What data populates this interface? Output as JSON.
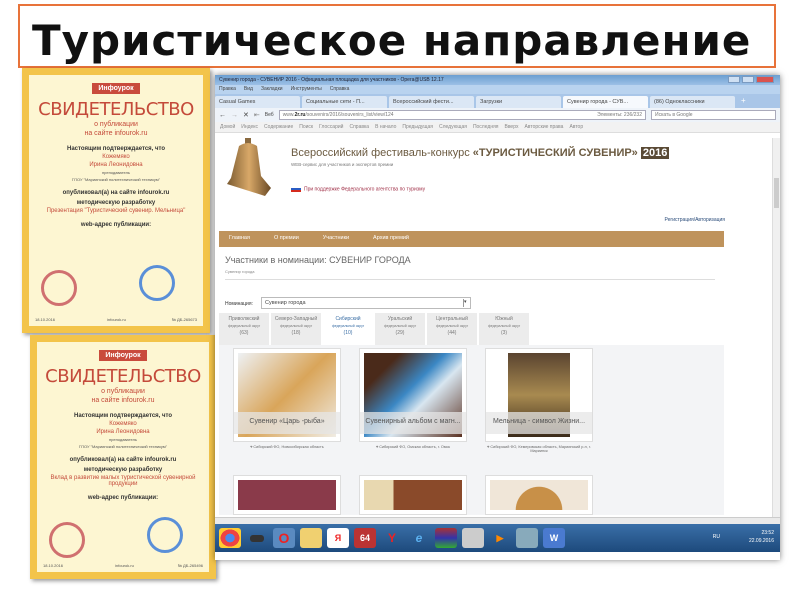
{
  "slide": {
    "title": "Туристическое направление"
  },
  "certificates": [
    {
      "logo": "Инфоурок",
      "heading": "СВИДЕТЕЛЬСТВО",
      "sub1": "о публикации",
      "sub2": "на сайте infourok.ru",
      "confirm": "Настоящим подтверждается, что",
      "surname": "Кожемяко",
      "name": "Ирина Леонидовна",
      "role": "преподаватель",
      "org": "ГПОУ \"Мариинский политехнический техникум\"",
      "published": "опубликовал(а) на сайте infourok.ru",
      "work_type": "методическую разработку",
      "work_title": "Презентация \"Туристический сувенир. Мельница\"",
      "web_label": "web-адрес публикации:",
      "site": "infourok.ru",
      "date": "18.10.2016",
      "number": "№ ДБ-265673"
    },
    {
      "logo": "Инфоурок",
      "heading": "СВИДЕТЕЛЬСТВО",
      "sub1": "о публикации",
      "sub2": "на сайте infourok.ru",
      "confirm": "Настоящим подтверждается, что",
      "surname": "Кожемяко",
      "name": "Ирина Леонидовна",
      "role": "преподаватель",
      "org": "ГПОУ \"Мариинский политехнический техникум\"",
      "published": "опубликовал(а) на сайте infourok.ru",
      "work_type": "методическую разработку",
      "work_title": "Вклад в развитие малых туристической сувенирной продукции",
      "web_label": "web-адрес публикации:",
      "site": "infourok.ru",
      "date": "18.10.2016",
      "number": "№ ДБ-265496"
    }
  ],
  "browser": {
    "window_title": "Сувенир города - СУВЕНИР 2016 - Официальная площадка для участников - Opera@USB 12.17",
    "menu": [
      "Правка",
      "Вид",
      "Закладки",
      "Инструменты",
      "Справка"
    ],
    "tabs": [
      {
        "label": "Casual Games"
      },
      {
        "label": "Социальные сети - П..."
      },
      {
        "label": "Всероссийский фести..."
      },
      {
        "label": "Загрузки"
      },
      {
        "label": "Сувенир города - СУВ...",
        "active": true
      },
      {
        "label": "(86) Одноклассники"
      }
    ],
    "address_prefix": "www.",
    "address_domain": "2r.ru",
    "address_path": "/souvenirs/2016/souvenirs_list/view/124",
    "web_badge": "Веб",
    "elements_count": "Элементы: 236/232",
    "search_placeholder": "Искать в Google",
    "nav_links": [
      "Домой",
      "Индекс",
      "Содержание",
      "Поиск",
      "Глоссарий",
      "Справка",
      "В начало",
      "Предыдущая",
      "Следующая",
      "Последняя",
      "Вверх",
      "Авторские права",
      "Автор"
    ]
  },
  "site": {
    "title_main": "Всероссийский фестиваль-конкурс ",
    "title_bold": "«ТУРИСТИЧЕСКИЙ СУВЕНИР»",
    "year": "2016",
    "subtitle": "WEB-сервис для участников и экспертов премии",
    "support": "При поддержке Федерального агентства по туризму",
    "register": "Регистрация/Авторизация",
    "nav": [
      "Главная",
      "О премии",
      "Участники",
      "Архив премий"
    ],
    "page_title": "Участники в номинации: СУВЕНИР ГОРОДА",
    "breadcrumb": "Сувенир города",
    "nomination_label": "Номинация:",
    "nomination_value": "Сувенир города",
    "district_sub": "федеральный округ",
    "districts": [
      {
        "name": "Приволжский",
        "count": "(63)"
      },
      {
        "name": "Северо-Западный",
        "count": "(18)"
      },
      {
        "name": "Сибирский",
        "count": "(10)",
        "active": true
      },
      {
        "name": "Уральский",
        "count": "(29)"
      },
      {
        "name": "Центральный",
        "count": "(44)"
      },
      {
        "name": "Южный",
        "count": "(3)"
      }
    ],
    "items": [
      {
        "caption": "Сувенир «Царь -рыба»",
        "location": "Сибирский ФО, Новосибирская область"
      },
      {
        "caption": "Сувенирный альбом с магн...",
        "location": "Сибирский ФО, Омская область, г. Омск"
      },
      {
        "caption": "Мельница - символ Жизни...",
        "location": "Сибирский ФО, Кемеровская область, Мариинский р-н, г. Мариинск"
      }
    ]
  },
  "taskbar": {
    "lang": "RU",
    "time": "23:52",
    "date": "22.09.2016",
    "apps": [
      "chrome",
      "mouse",
      "opera",
      "folder",
      "yandex",
      "64",
      "yandex-browser",
      "ie",
      "winrar",
      "user",
      "media",
      "app",
      "word"
    ]
  }
}
